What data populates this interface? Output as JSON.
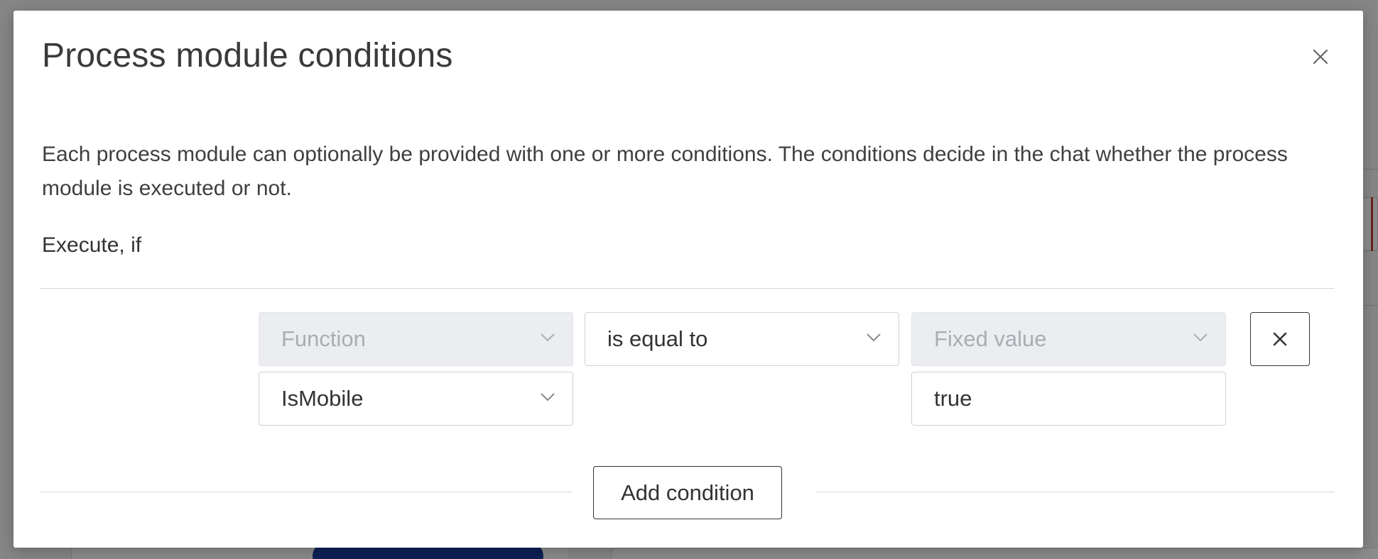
{
  "modal": {
    "title": "Process module conditions",
    "description": "Each process module can optionally be provided with one or more conditions. The conditions decide in the chat whether the process module is executed or not.",
    "section_label": "Execute, if"
  },
  "condition": {
    "left_type": "Function",
    "left_value": "IsMobile",
    "operator": "is equal to",
    "right_type": "Fixed value",
    "right_value": "true"
  },
  "actions": {
    "add_condition_label": "Add condition"
  },
  "icons": {
    "close": "close-icon",
    "remove": "remove-condition-icon",
    "chevron": "chevron-down-icon"
  },
  "colors": {
    "disabled_bg": "#ebedf0",
    "disabled_text": "#a9aeb3",
    "border": "#cfd2d6",
    "text": "#333333"
  }
}
